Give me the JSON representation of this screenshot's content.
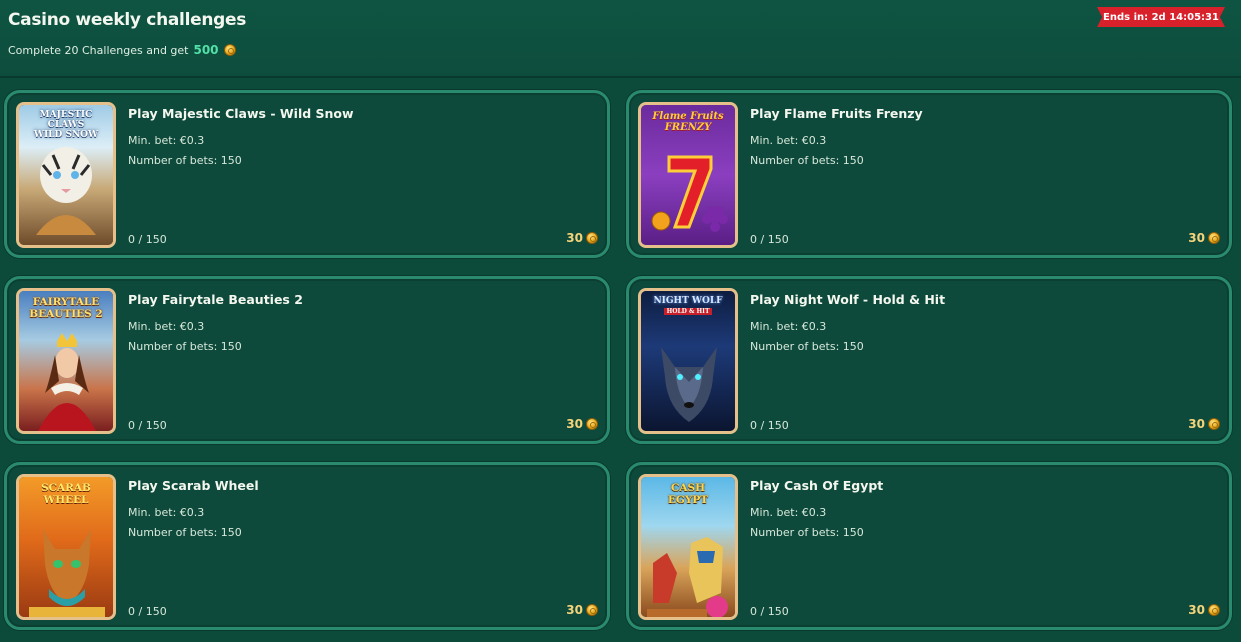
{
  "header": {
    "title": "Casino weekly challenges",
    "subtitle": "Complete 20 Challenges and get",
    "reward_amount": "500",
    "ends_in": "Ends in: 2d 14:05:31"
  },
  "challenges": [
    {
      "title": "Play Majestic Claws - Wild Snow",
      "min_bet": "Min. bet: €0.3",
      "bets": "Number of bets: 150",
      "progress": "0 / 150",
      "reward": "30",
      "logo": "MAJESTIC CLAWS WILD SNOW"
    },
    {
      "title": "Play Flame Fruits Frenzy",
      "min_bet": "Min. bet: €0.3",
      "bets": "Number of bets: 150",
      "progress": "0 / 150",
      "reward": "30",
      "logo": "Flame Fruits FRENZY"
    },
    {
      "title": "Play Fairytale Beauties 2",
      "min_bet": "Min. bet: €0.3",
      "bets": "Number of bets: 150",
      "progress": "0 / 150",
      "reward": "30",
      "logo": "FAIRYTALE BEAUTIES 2"
    },
    {
      "title": "Play Night Wolf - Hold & Hit",
      "min_bet": "Min. bet: €0.3",
      "bets": "Number of bets: 150",
      "progress": "0 / 150",
      "reward": "30",
      "logo": "NIGHT WOLF HOLD & HIT"
    },
    {
      "title": "Play Scarab Wheel",
      "min_bet": "Min. bet: €0.3",
      "bets": "Number of bets: 150",
      "progress": "0 / 150",
      "reward": "30",
      "logo": "SCARAB WHEEL"
    },
    {
      "title": "Play Cash Of Egypt",
      "min_bet": "Min. bet: €0.3",
      "bets": "Number of bets: 150",
      "progress": "0 / 150",
      "reward": "30",
      "logo": "CASH OF EGYPT"
    }
  ]
}
